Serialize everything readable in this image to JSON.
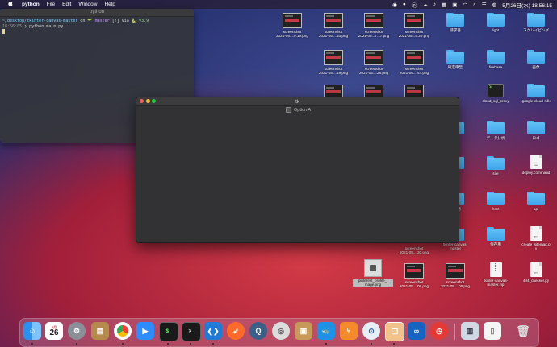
{
  "menubar": {
    "apple": "",
    "app": "python",
    "items": [
      "File",
      "Edit",
      "Window",
      "Help"
    ],
    "datetime": "5月26日(水) 18:56:15"
  },
  "terminal": {
    "title": "python",
    "line1_path": "~/desktop/tkinter-canvas-master",
    "line1_on": "on",
    "line1_branch": "master",
    "line1_rest": "[!] via",
    "line1_ver": "v3.9",
    "line2_time": "18:56:05",
    "line2_cmd": "python main.py"
  },
  "tk": {
    "title": "tk",
    "checkbox_label": "Option A"
  },
  "desktop": {
    "shot1": "screenshot\n2021-05....9.19.png",
    "shot2": "screenshot\n2021-05....53.png",
    "shot3": "screenshot\n2021-05...7.17.png",
    "shot4": "screenshot\n2021-05...5.20.png",
    "f_seikyu": "請求書",
    "f_light": "light",
    "f_scraping": "スクレイピング",
    "shot5": "screenshot\n2021-05....49.png",
    "shot6": "screenshot\n2021-05....28.png",
    "shot7": "screenshot\n2021-05....44.png",
    "f_kakutei": "確定申告",
    "f_firebase": "firebase",
    "f_gazo": "画像",
    "t_cloudsql": "cloud_sql_proxy",
    "t_gcloud": "google-cloud-sdk",
    "f_data": "データ分析",
    "f_logo": "ロゴ",
    "f_site": "site",
    "d_deploy": "deploy.command",
    "f_shutsu": "出品物",
    "f_front": "front",
    "f_api": "api",
    "d_sitemap": "create_sitemap.p\ny",
    "shot8": "screenshot\n2021-05....20.png",
    "f_tkinter": "tkinter-canvas-\nmaster",
    "f_hozon": "保存用",
    "pin": "pinterest_profile_i\nmage.png",
    "shot9": "screenshot\n2021-05....09.png",
    "shot10": "screenshot\n2021-05....08.png",
    "z_tkinter": "tkinter-canvas-\nmaster.zip",
    "d_404": "404_checker.py"
  },
  "dock": {
    "calendar_day": "26",
    "calendar_month": "5月"
  },
  "colors": {
    "folder": "#4fb1ee",
    "close": "#fe5f57",
    "minimize": "#febc2e",
    "zoom": "#28c840"
  }
}
